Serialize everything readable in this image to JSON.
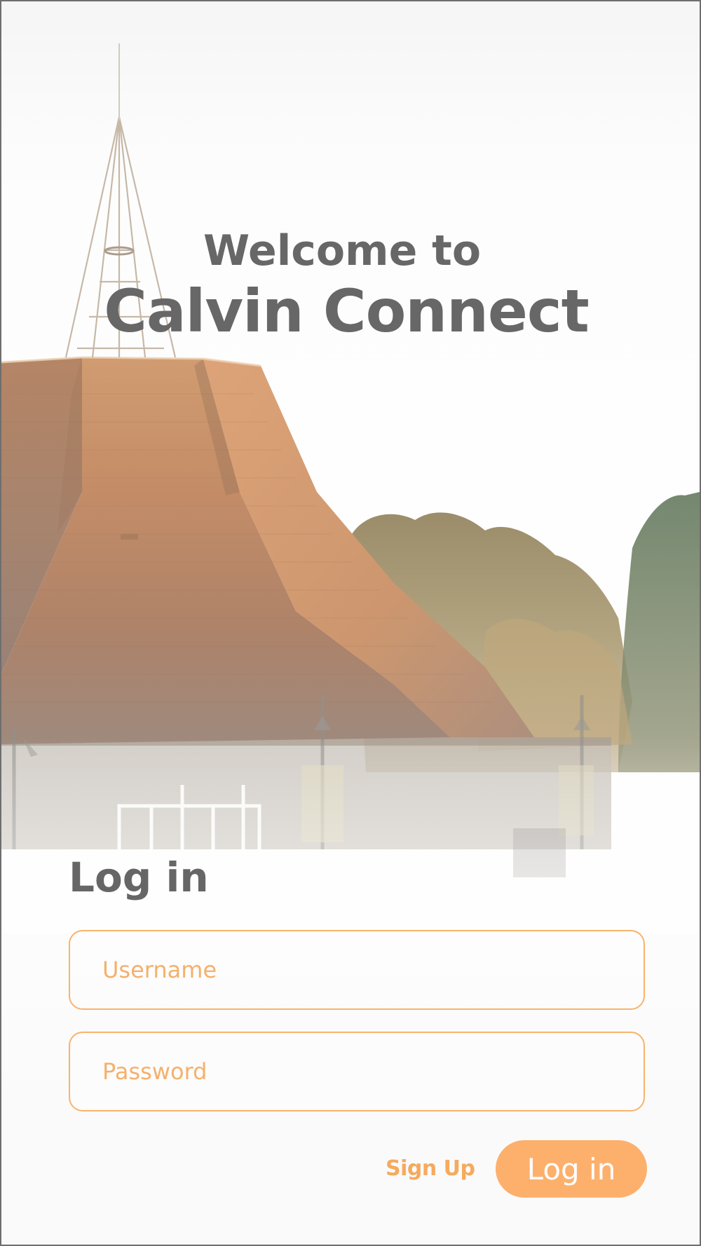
{
  "welcome": {
    "line1": "Welcome to",
    "line2": "Calvin Connect"
  },
  "login": {
    "heading": "Log in",
    "username_placeholder": "Username",
    "password_placeholder": "Password",
    "signup_label": "Sign Up",
    "submit_label": "Log in"
  },
  "colors": {
    "accent": "#fdb06c",
    "field_border": "#f9b36c",
    "title_text": "#676767"
  },
  "background": {
    "subject": "campus chapel with copper hexagonal roof and spire, trees, fading to white"
  }
}
